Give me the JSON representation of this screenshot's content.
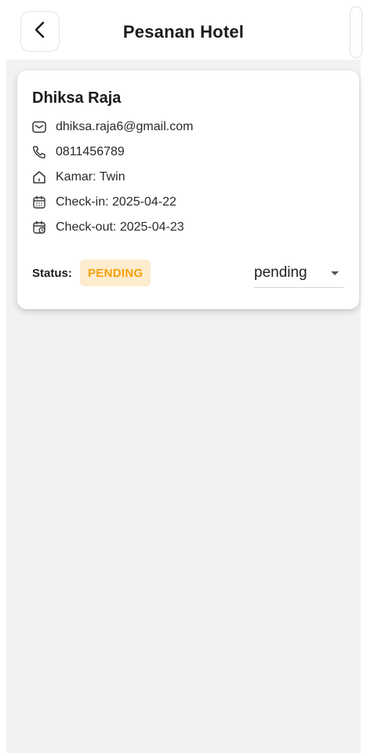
{
  "appbar": {
    "title": "Pesanan Hotel"
  },
  "order": {
    "name": "Dhiksa Raja",
    "email": "dhiksa.raja6@gmail.com",
    "phone": "0811456789",
    "room": "Kamar: Twin",
    "check_in": "Check-in: 2025-04-22",
    "check_out": "Check-out: 2025-04-23",
    "status_label": "Status:",
    "status_badge": "PENDING",
    "status_select_value": "pending"
  },
  "icons": {
    "back": "chevron-left-icon",
    "email": "mail-icon",
    "phone": "phone-icon",
    "room": "home-icon",
    "check_in": "calendar-icon",
    "check_out": "calendar-clock-icon",
    "select": "dropdown-arrow-icon"
  },
  "colors": {
    "badge_bg": "#fdeccd",
    "badge_text": "#f5a00c",
    "background": "#f2f2f3"
  }
}
